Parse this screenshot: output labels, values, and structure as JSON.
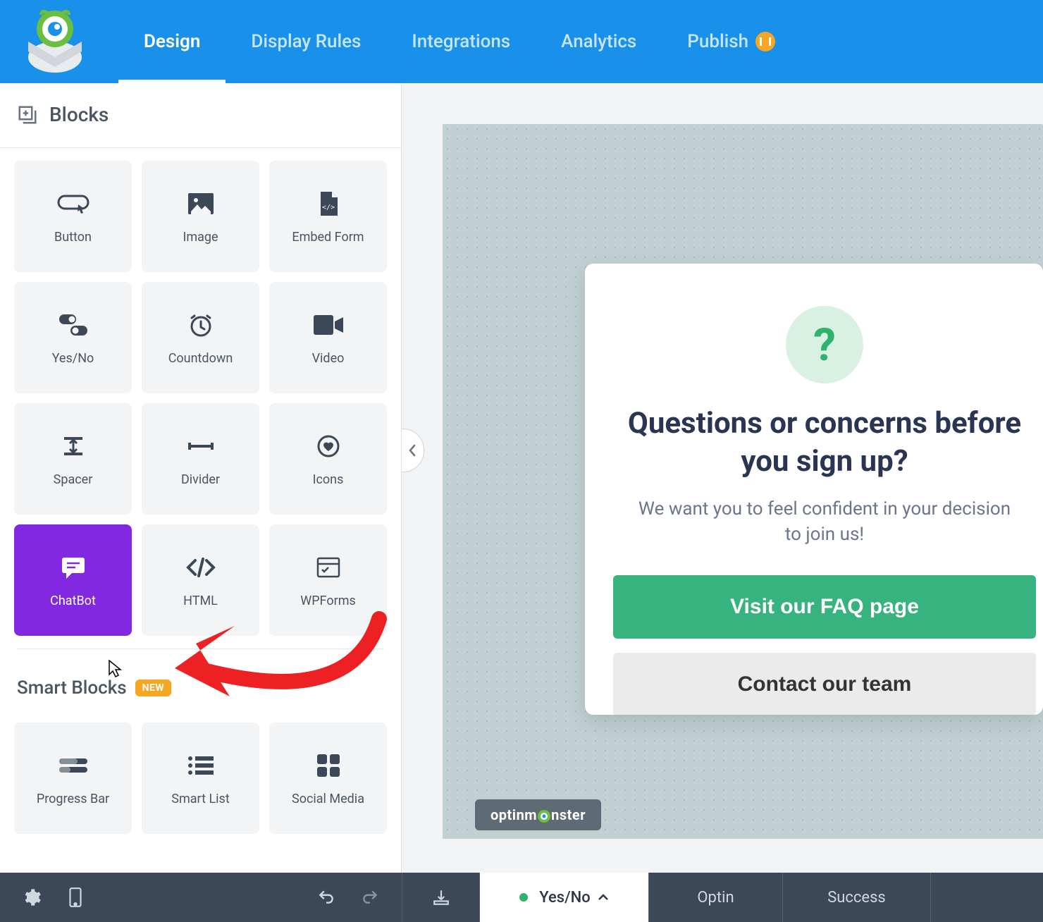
{
  "nav": {
    "tabs": [
      "Design",
      "Display Rules",
      "Integrations",
      "Analytics",
      "Publish"
    ],
    "active": "Design",
    "publish_status": "paused"
  },
  "sidebar": {
    "header": "Blocks",
    "blocks": [
      {
        "label": "Button",
        "icon": "button-icon"
      },
      {
        "label": "Image",
        "icon": "image-icon"
      },
      {
        "label": "Embed Form",
        "icon": "file-code-icon"
      },
      {
        "label": "Yes/No",
        "icon": "yesno-icon"
      },
      {
        "label": "Countdown",
        "icon": "clock-icon"
      },
      {
        "label": "Video",
        "icon": "video-icon"
      },
      {
        "label": "Spacer",
        "icon": "spacer-icon"
      },
      {
        "label": "Divider",
        "icon": "divider-icon"
      },
      {
        "label": "Icons",
        "icon": "heart-icon"
      },
      {
        "label": "ChatBot",
        "icon": "chat-icon",
        "active": true
      },
      {
        "label": "HTML",
        "icon": "code-icon"
      },
      {
        "label": "WPForms",
        "icon": "form-icon"
      }
    ],
    "smart_header": "Smart Blocks",
    "smart_badge": "NEW",
    "smart_blocks": [
      {
        "label": "Progress Bar",
        "icon": "progress-icon"
      },
      {
        "label": "Smart List",
        "icon": "list-icon"
      },
      {
        "label": "Social Media",
        "icon": "social-icon"
      }
    ]
  },
  "canvas": {
    "popup": {
      "heading_line1": "Questions or concerns before",
      "heading_line2": "you sign up?",
      "subtext_line1": "We want you to feel confident in your decision",
      "subtext_line2": "to join us!",
      "primary_btn": "Visit our FAQ page",
      "secondary_btn": "Contact our team"
    },
    "watermark": "optinm   nster"
  },
  "bottombar": {
    "views": [
      "Yes/No",
      "Optin",
      "Success"
    ],
    "active_view": "Yes/No"
  }
}
